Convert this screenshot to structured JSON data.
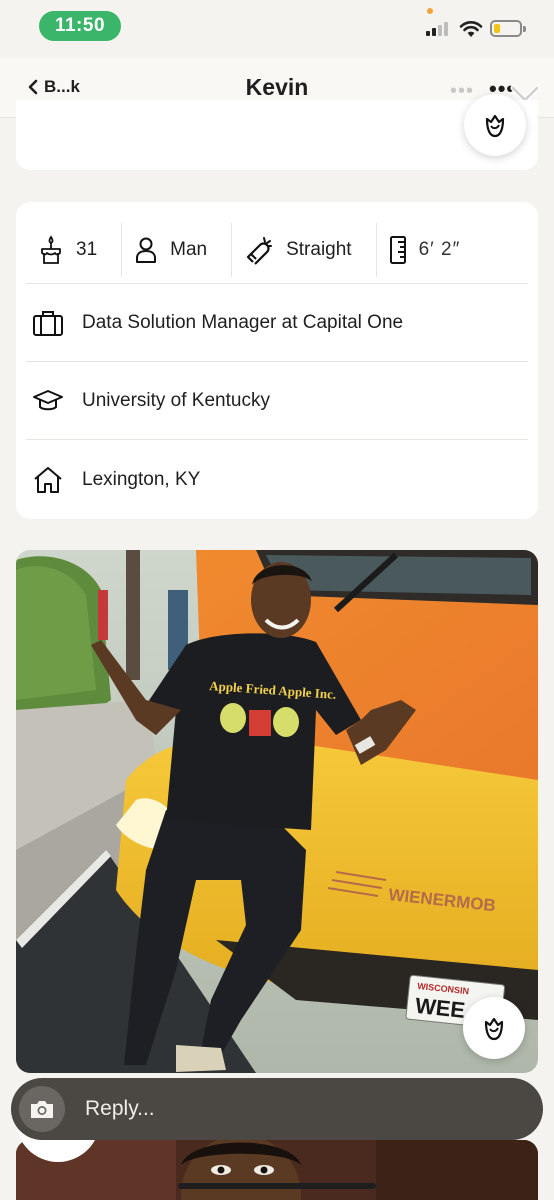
{
  "status_bar": {
    "time": "11:50",
    "battery_level": 0.25,
    "icons": [
      "signal-icon",
      "wifi-icon",
      "battery-icon"
    ]
  },
  "nav": {
    "back_label": "B...k",
    "title": "Kevin",
    "icons": [
      "chevron-left-icon",
      "more-icon",
      "close-icon"
    ]
  },
  "vitals": {
    "age": "31",
    "gender": "Man",
    "orientation": "Straight",
    "height": "6′ 2″",
    "icons": [
      "birthday-cake-icon",
      "person-icon",
      "magnet-icon",
      "ruler-icon"
    ]
  },
  "details": {
    "job": "Data Solution Manager at Capital One",
    "school": "University of Kentucky",
    "hometown": "Lexington, KY",
    "icons": [
      "briefcase-icon",
      "graduation-cap-icon",
      "house-icon"
    ]
  },
  "photo": {
    "shirt_text": "Apple Fried Apple Inc.",
    "plate_text": "WISCONSIN",
    "plate_number": "WEE",
    "vehicle_text": "WIENERMOB"
  },
  "reply": {
    "placeholder": "Reply...",
    "icons": [
      "camera-icon",
      "rose-icon"
    ]
  },
  "colors": {
    "background": "#f4f3ef",
    "card": "#ffffff",
    "time_pill": "#3bb56a",
    "reply_bar": "#4b4742"
  }
}
